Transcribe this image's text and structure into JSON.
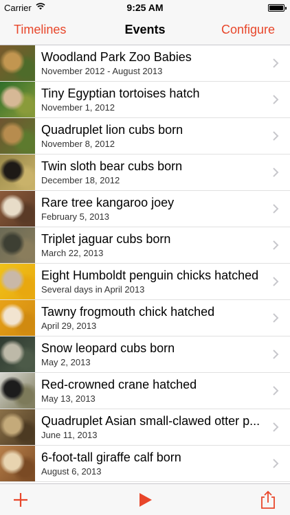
{
  "status_bar": {
    "carrier": "Carrier",
    "time": "9:25 AM"
  },
  "nav": {
    "left": "Timelines",
    "title": "Events",
    "right": "Configure"
  },
  "accent_color": "#e8462a",
  "events": [
    {
      "title": "Woodland Park Zoo Babies",
      "subtitle": "November 2012 - August 2013",
      "thumb": "lion cubs photo",
      "colors": [
        "#7a5a2c",
        "#c29650",
        "#4e6b2a"
      ]
    },
    {
      "title": "Tiny Egyptian tortoises hatch",
      "subtitle": "November 1, 2012",
      "thumb": "tortoise in hand photo",
      "colors": [
        "#2f6e2a",
        "#d6b896",
        "#8a9b3a"
      ]
    },
    {
      "title": "Quadruplet lion cubs born",
      "subtitle": "November 8, 2012",
      "thumb": "lion cubs photo",
      "colors": [
        "#6f5430",
        "#b78c4e",
        "#5d7a2e"
      ]
    },
    {
      "title": "Twin sloth bear cubs born",
      "subtitle": "December 18, 2012",
      "thumb": "sloth bear cubs photo",
      "colors": [
        "#9a8a4a",
        "#1e1a16",
        "#c9b26a"
      ]
    },
    {
      "title": "Rare tree kangaroo joey",
      "subtitle": "February 5, 2013",
      "thumb": "tree kangaroo joey photo",
      "colors": [
        "#8b5a3a",
        "#e8dcc8",
        "#5a3a26"
      ]
    },
    {
      "title": "Triplet jaguar cubs born",
      "subtitle": "March 22, 2013",
      "thumb": "jaguar cubs photo",
      "colors": [
        "#6b6a55",
        "#3d3f33",
        "#8a7d5c"
      ]
    },
    {
      "title": "Eight Humboldt penguin chicks hatched",
      "subtitle": "Several days in April 2013",
      "thumb": "penguin chick photo",
      "colors": [
        "#f0c21a",
        "#c9b8a8",
        "#e8a80f"
      ]
    },
    {
      "title": "Tawny frogmouth chick hatched",
      "subtitle": "April 29, 2013",
      "thumb": "frogmouth chick photo",
      "colors": [
        "#e8a218",
        "#f2e4d0",
        "#d08a10"
      ]
    },
    {
      "title": "Snow leopard cubs born",
      "subtitle": "May 2, 2013",
      "thumb": "snow leopard cubs photo",
      "colors": [
        "#2e3a30",
        "#bdb9a8",
        "#4c5a48"
      ]
    },
    {
      "title": "Red-crowned crane hatched",
      "subtitle": "May 13, 2013",
      "thumb": "crane chick photo",
      "colors": [
        "#d8d8d2",
        "#1c1c1c",
        "#7d7a5a"
      ]
    },
    {
      "title": "Quadruplet Asian small-clawed otter p...",
      "subtitle": "June 11, 2013",
      "thumb": "otter pups photo",
      "colors": [
        "#8a7048",
        "#c4aa7a",
        "#4c3a22"
      ]
    },
    {
      "title": "6-foot-tall giraffe calf born",
      "subtitle": "August 6, 2013",
      "thumb": "giraffe calf photo",
      "colors": [
        "#b8804a",
        "#e8d4b0",
        "#7a4a24"
      ]
    }
  ],
  "toolbar": {
    "add": "add-icon",
    "play": "play-icon",
    "share": "share-icon"
  }
}
